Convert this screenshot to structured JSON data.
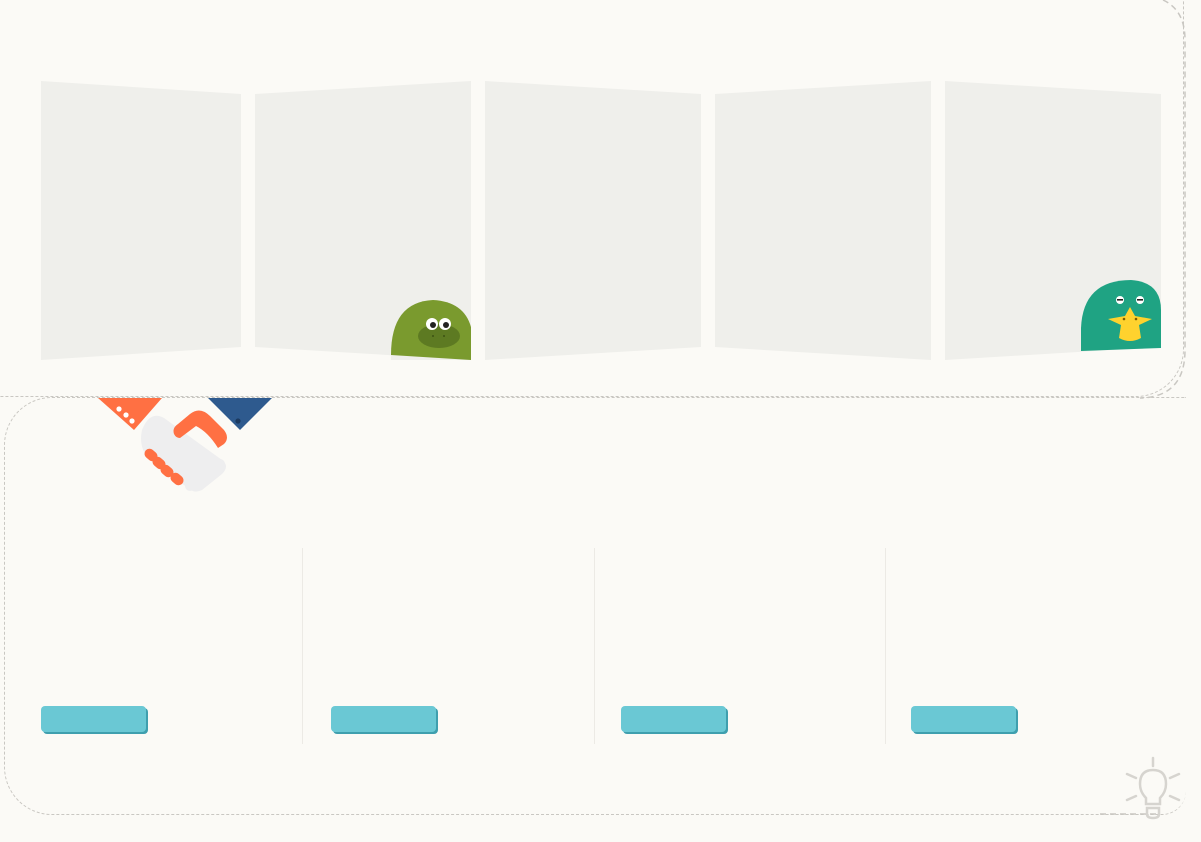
{
  "panels": [
    {
      "id": "panel-1",
      "label": ""
    },
    {
      "id": "panel-2",
      "label": ""
    },
    {
      "id": "panel-3",
      "label": ""
    },
    {
      "id": "panel-4",
      "label": ""
    },
    {
      "id": "panel-5",
      "label": ""
    }
  ],
  "mascots": {
    "frog": {
      "icon": "frog-mascot-icon",
      "color": "#7a9a2e"
    },
    "duck": {
      "icon": "duck-mascot-icon",
      "color": "#1fa383"
    }
  },
  "handshake": {
    "icon": "handshake-icon"
  },
  "columns": [
    {
      "button_label": ""
    },
    {
      "button_label": ""
    },
    {
      "button_label": ""
    },
    {
      "button_label": ""
    }
  ],
  "hint": {
    "icon": "lightbulb-icon"
  },
  "colors": {
    "background": "#fbfaf6",
    "panel": "#efefeb",
    "button": "#6ac8d4",
    "button_shadow": "#3f9fae",
    "accent_orange": "#ff7043",
    "accent_navy": "#2e5a8e"
  }
}
